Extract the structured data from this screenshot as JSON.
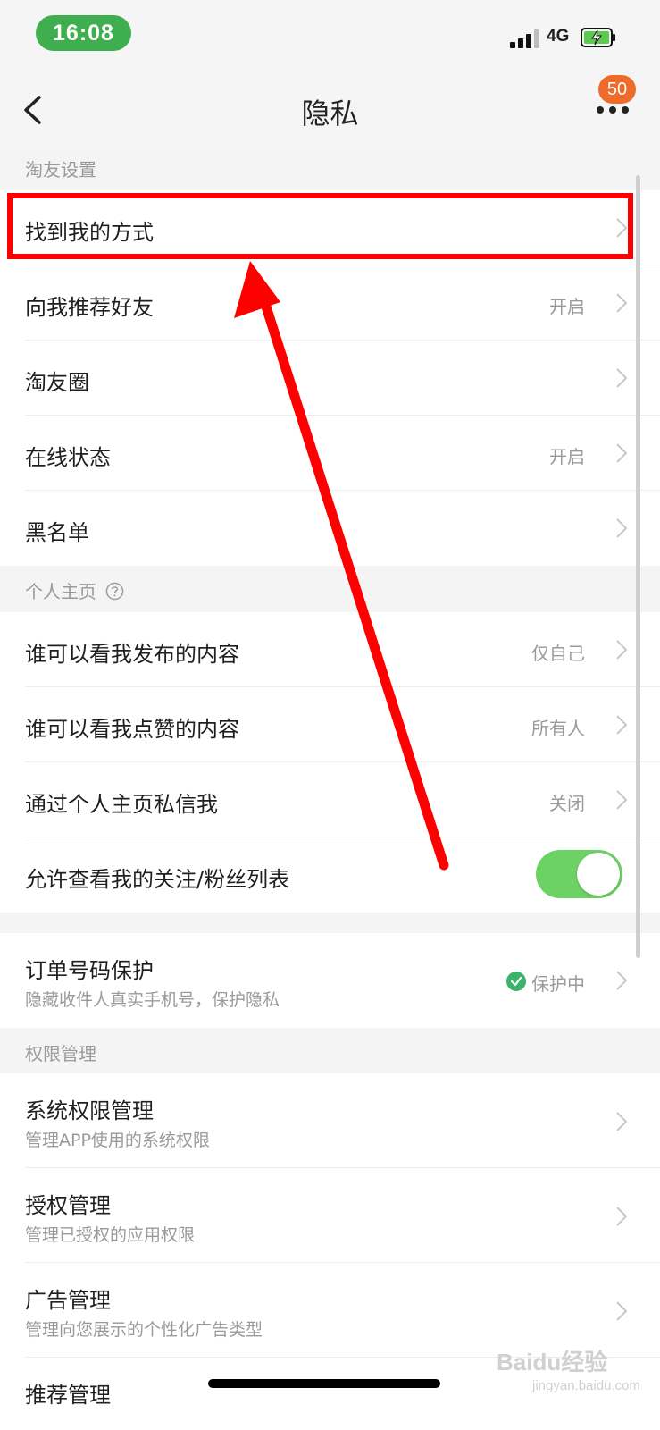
{
  "status_bar": {
    "time": "16:08",
    "network": "4G"
  },
  "nav": {
    "title": "隐私",
    "badge": "50"
  },
  "sections": {
    "friends": "淘友设置",
    "homepage": "个人主页",
    "permissions": "权限管理"
  },
  "rows": {
    "find_me": {
      "label": "找到我的方式"
    },
    "recommend": {
      "label": "向我推荐好友",
      "value": "开启"
    },
    "circle": {
      "label": "淘友圈"
    },
    "online": {
      "label": "在线状态",
      "value": "开启"
    },
    "blacklist": {
      "label": "黑名单"
    },
    "who_posts": {
      "label": "谁可以看我发布的内容",
      "value": "仅自己"
    },
    "who_likes": {
      "label": "谁可以看我点赞的内容",
      "value": "所有人"
    },
    "dm": {
      "label": "通过个人主页私信我",
      "value": "关闭"
    },
    "follow_list": {
      "label": "允许查看我的关注/粉丝列表",
      "toggle_on": true
    },
    "order": {
      "label": "订单号码保护",
      "sub": "隐藏收件人真实手机号，保护隐私",
      "value": "保护中"
    },
    "sys_perm": {
      "label": "系统权限管理",
      "sub": "管理APP使用的系统权限"
    },
    "auth": {
      "label": "授权管理",
      "sub": "管理已授权的应用权限"
    },
    "ads": {
      "label": "广告管理",
      "sub": "管理向您展示的个性化广告类型"
    },
    "recommend_mgmt": {
      "label": "推荐管理"
    }
  },
  "watermark": {
    "brand": "Baidu经验",
    "url": "jingyan.baidu.com"
  },
  "colors": {
    "toggle_on": "#6dd264",
    "badge": "#ef6b2a",
    "annotation": "#ff0000",
    "check": "#3bb36b"
  }
}
